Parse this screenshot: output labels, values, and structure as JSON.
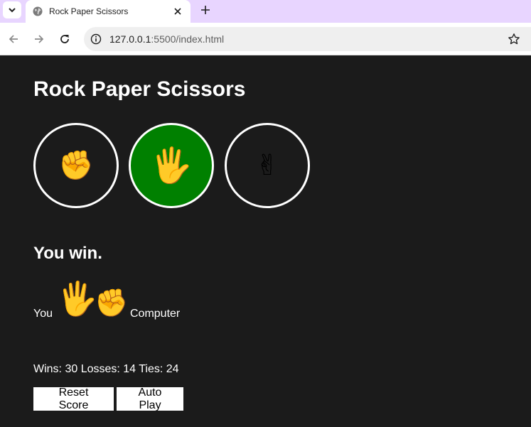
{
  "browser": {
    "tab_title": "Rock Paper Scissors",
    "url_host": "127.0.0.1",
    "url_path": ":5500/index.html"
  },
  "game": {
    "title": "Rock Paper Scissors",
    "moves": [
      {
        "name": "rock",
        "icon": "raised-fist-icon",
        "emoji": "✊",
        "selected": false
      },
      {
        "name": "paper",
        "icon": "raised-hand-icon",
        "emoji": "🖐",
        "selected": true
      },
      {
        "name": "scissors",
        "icon": "victory-hand-icon",
        "emoji": "✌",
        "selected": false
      }
    ],
    "selected_color": "#008000",
    "result": "You win.",
    "player_label": "You",
    "computer_label": "Computer",
    "player_move_emoji": "🖐",
    "computer_move_emoji": "✊",
    "score_text": "Wins: 30 Losses: 14 Ties: 24",
    "reset_label": "Reset Score",
    "autoplay_label": "Auto Play"
  }
}
